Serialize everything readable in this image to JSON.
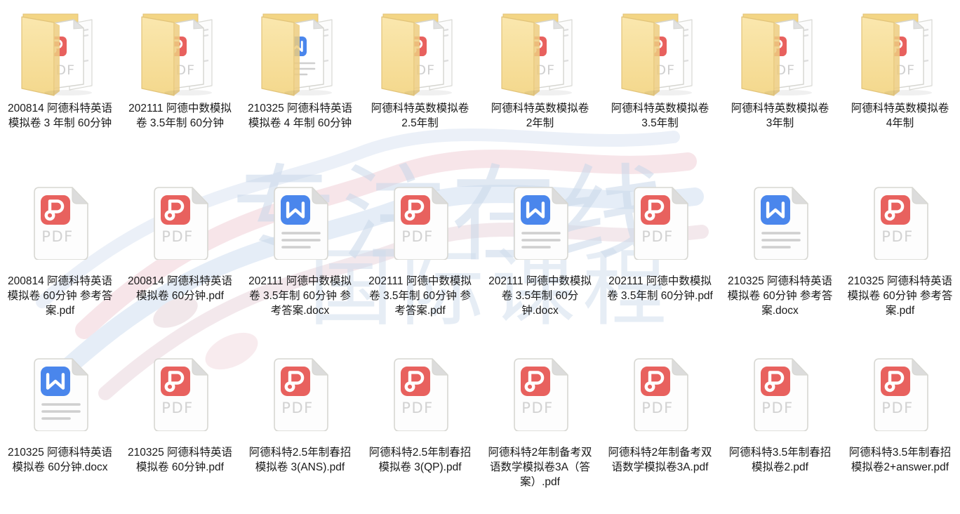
{
  "window": {
    "background_color": "#ffffff",
    "layout": "icon-grid",
    "columns": 8,
    "rows": 3
  },
  "watermark": {
    "line1": "专注在线",
    "line2": "国际课程",
    "color": "#c9d8ea",
    "ribbon_pink": "#f3d3d8",
    "ribbon_blue": "#ccdcf0"
  },
  "icon_colors": {
    "folder_front": "#f7dd9a",
    "folder_back": "#f3d584",
    "folder_edge": "#e3c377",
    "page_white": "#fdfdfd",
    "page_border": "#d7d7d2",
    "pdf_red": "#e8615e",
    "word_blue": "#4a86ec",
    "pdf_text_gray": "#d2d2d2",
    "line_gray": "#cfcfcf",
    "label_text": "#1a1a1a"
  },
  "items": [
    {
      "type": "folder",
      "inner_icon": "pdf-icon",
      "name": "200814 阿德科特英语模拟卷 3 年制 60分钟"
    },
    {
      "type": "folder",
      "inner_icon": "pdf-icon",
      "name": "202111 阿德中数模拟卷 3.5年制 60分钟"
    },
    {
      "type": "folder",
      "inner_icon": "word-icon",
      "name": "210325 阿德科特英语模拟卷 4 年制 60分钟"
    },
    {
      "type": "folder",
      "inner_icon": "pdf-icon",
      "name": "阿德科特英数模拟卷 2.5年制"
    },
    {
      "type": "folder",
      "inner_icon": "pdf-icon",
      "name": "阿德科特英数模拟卷 2年制"
    },
    {
      "type": "folder",
      "inner_icon": "pdf-icon",
      "name": "阿德科特英数模拟卷 3.5年制"
    },
    {
      "type": "folder",
      "inner_icon": "pdf-icon",
      "name": "阿德科特英数模拟卷 3年制"
    },
    {
      "type": "folder",
      "inner_icon": "pdf-icon",
      "name": "阿德科特英数模拟卷 4年制"
    },
    {
      "type": "file",
      "inner_icon": "pdf-icon",
      "name": "200814 阿德科特英语模拟卷 60分钟 参考答案.pdf"
    },
    {
      "type": "file",
      "inner_icon": "pdf-icon",
      "name": "200814 阿德科特英语模拟卷 60分钟.pdf"
    },
    {
      "type": "file",
      "inner_icon": "word-icon",
      "name": "202111 阿德中数模拟卷 3.5年制 60分钟 参考答案.docx"
    },
    {
      "type": "file",
      "inner_icon": "pdf-icon",
      "name": "202111 阿德中数模拟卷 3.5年制 60分钟 参考答案.pdf"
    },
    {
      "type": "file",
      "inner_icon": "word-icon",
      "name": "202111 阿德中数模拟卷 3.5年制 60分钟.docx"
    },
    {
      "type": "file",
      "inner_icon": "pdf-icon",
      "name": "202111 阿德中数模拟卷 3.5年制 60分钟.pdf"
    },
    {
      "type": "file",
      "inner_icon": "word-icon",
      "name": "210325 阿德科特英语模拟卷 60分钟 参考答案.docx"
    },
    {
      "type": "file",
      "inner_icon": "pdf-icon",
      "name": "210325 阿德科特英语模拟卷 60分钟 参考答案.pdf"
    },
    {
      "type": "file",
      "inner_icon": "word-icon",
      "name": "210325 阿德科特英语模拟卷 60分钟.docx"
    },
    {
      "type": "file",
      "inner_icon": "pdf-icon",
      "name": "210325 阿德科特英语模拟卷 60分钟.pdf"
    },
    {
      "type": "file",
      "inner_icon": "pdf-icon",
      "name": "阿德科特2.5年制春招模拟卷 3(ANS).pdf"
    },
    {
      "type": "file",
      "inner_icon": "pdf-icon",
      "name": "阿德科特2.5年制春招模拟卷 3(QP).pdf"
    },
    {
      "type": "file",
      "inner_icon": "pdf-icon",
      "name": "阿德科特2年制备考双语数学模拟卷3A（答案）.pdf"
    },
    {
      "type": "file",
      "inner_icon": "pdf-icon",
      "name": "阿德科特2年制备考双语数学模拟卷3A.pdf"
    },
    {
      "type": "file",
      "inner_icon": "pdf-icon",
      "name": "阿德科特3.5年制春招模拟卷2.pdf"
    },
    {
      "type": "file",
      "inner_icon": "pdf-icon",
      "name": "阿德科特3.5年制春招模拟卷2+answer.pdf"
    }
  ]
}
